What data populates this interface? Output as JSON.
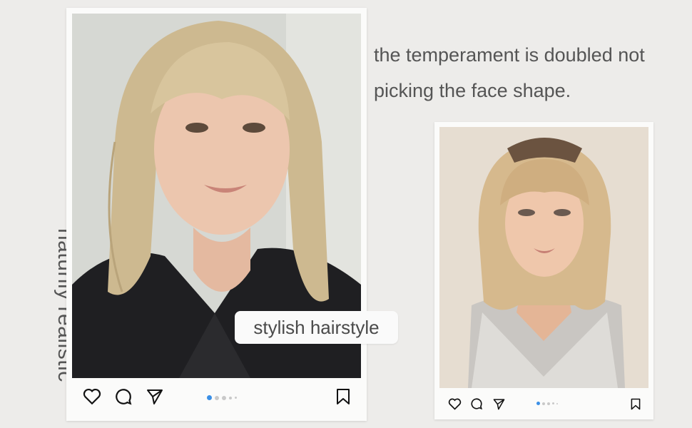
{
  "headline": {
    "line1": "the temperament is doubled not",
    "line2": "picking the face shape."
  },
  "side_caption": "naturlly realistic",
  "overlay_label": "stylish hairstyle",
  "posts": [
    {
      "photo_subject": "woman with blonde bob and bangs wearing black blazer",
      "icons": [
        "heart-icon",
        "comment-icon",
        "send-icon",
        "bookmark-icon"
      ],
      "carousel": {
        "count": 5,
        "active_index": 0
      }
    },
    {
      "photo_subject": "mannequin wearing blonde ombre bob wig with bangs",
      "icons": [
        "heart-icon",
        "comment-icon",
        "send-icon",
        "bookmark-icon"
      ],
      "carousel": {
        "count": 5,
        "active_index": 0
      }
    }
  ],
  "colors": {
    "background": "#edecea",
    "card": "#fbfbfa",
    "text": "#555555",
    "active_dot": "#3b8fe6"
  }
}
